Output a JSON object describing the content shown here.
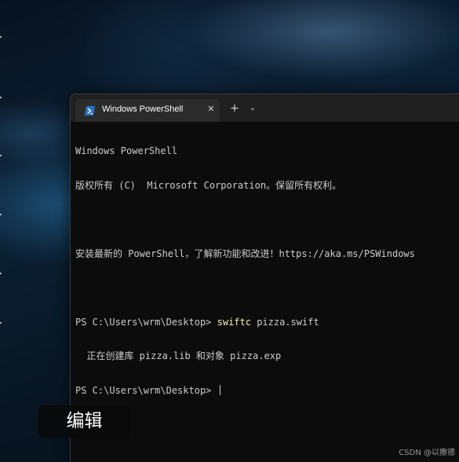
{
  "tab": {
    "icon": "powershell-icon",
    "title": "Windows PowerShell",
    "close_icon": "close-icon"
  },
  "toolbar": {
    "new_tab_icon": "plus-icon",
    "dropdown_icon": "chevron-down-icon"
  },
  "console": {
    "line1": "Windows PowerShell",
    "line2": "版权所有 (C)  Microsoft Corporation。保留所有权利。",
    "line3": "",
    "line4": "安装最新的 PowerShell，了解新功能和改进！https://aka.ms/PSWindows",
    "line5": "",
    "line6_prompt": "PS C:\\Users\\wrm\\Desktop> ",
    "line6_command": "swiftc",
    "line6_args": " pizza.swift",
    "line7": "  正在创建库 pizza.lib 和对象 pizza.exp",
    "line8_prompt": "PS C:\\Users\\wrm\\Desktop> "
  },
  "overlay": {
    "label": "编辑"
  },
  "watermark": {
    "text": "CSDN @以撒德"
  },
  "colors": {
    "terminal_bg": "#0c0c0c",
    "terminal_fg": "#cccccc",
    "command_highlight": "#f9f1a5",
    "tab_active": "#2b2b2b",
    "tab_bar": "#202020"
  }
}
